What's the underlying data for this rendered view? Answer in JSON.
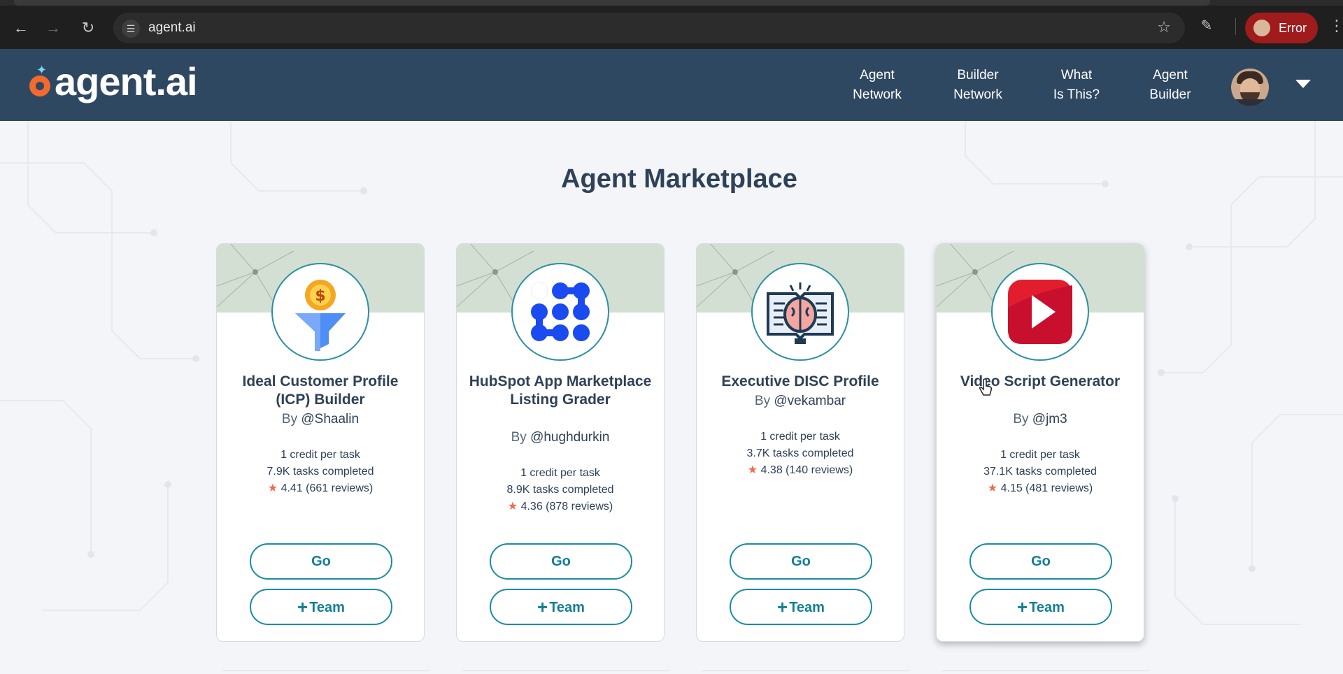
{
  "browser": {
    "url": "agent.ai",
    "profile_status": "Error",
    "icons": {
      "back": "arrow-left-icon",
      "forward": "arrow-right-icon",
      "reload": "reload-icon",
      "site_settings": "tune-icon",
      "bookmark": "star-outline-icon",
      "extensions": "puzzle-icon",
      "menu": "kebab-menu-icon"
    }
  },
  "header": {
    "logo_text": "agent.ai",
    "nav": [
      {
        "line1": "Agent",
        "line2": "Network"
      },
      {
        "line1": "Builder",
        "line2": "Network"
      },
      {
        "line1": "What",
        "line2": "Is This?"
      },
      {
        "line1": "Agent",
        "line2": "Builder"
      }
    ]
  },
  "main": {
    "title": "Agent Marketplace",
    "cards": [
      {
        "title": "Ideal Customer Profile (ICP) Builder",
        "by": "By",
        "author": "@Shaalin",
        "credits": "1 credit per task",
        "tasks": "7.9K tasks completed",
        "rating": "4.41 (661 reviews)",
        "go_label": "Go",
        "team_label": "Team",
        "icon": "funnel-dollar-icon"
      },
      {
        "title": "HubSpot App Marketplace Listing Grader",
        "by": "By",
        "author": "@hughdurkin",
        "credits": "1 credit per task",
        "tasks": "8.9K tasks completed",
        "rating": "4.36 (878 reviews)",
        "go_label": "Go",
        "team_label": "Team",
        "icon": "network-dots-icon"
      },
      {
        "title": "Executive DISC Profile",
        "by": "By",
        "author": "@vekambar",
        "credits": "1 credit per task",
        "tasks": "3.7K tasks completed",
        "rating": "4.38 (140 reviews)",
        "go_label": "Go",
        "team_label": "Team",
        "icon": "brain-book-icon"
      },
      {
        "title": "Video Script Generator",
        "by": "By",
        "author": "@jm3",
        "credits": "1 credit per task",
        "tasks": "37.1K tasks completed",
        "rating": "4.15 (481 reviews)",
        "go_label": "Go",
        "team_label": "Team",
        "icon": "play-button-icon"
      }
    ]
  },
  "colors": {
    "header_bg": "#2f4862",
    "accent": "#1a8ca3",
    "star": "#f06c4f",
    "title_text": "#2e4157"
  }
}
